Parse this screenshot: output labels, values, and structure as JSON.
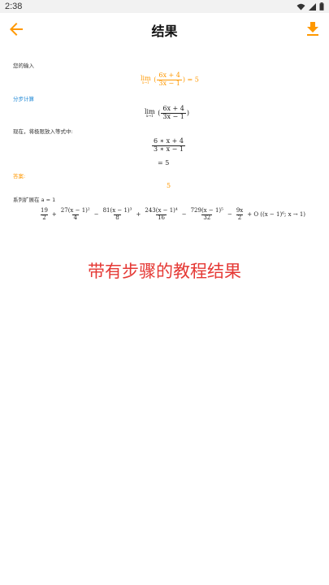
{
  "status_bar": {
    "time": "2:38"
  },
  "app_bar": {
    "title": "结果"
  },
  "result": {
    "input_label": "您的输入",
    "input_expr": {
      "lim_sub": "x→1",
      "numerator": "6x + 4",
      "denominator": "3x − 1",
      "rhs": "= 5"
    },
    "steps_label": "分步计算",
    "step_expr": {
      "lim_sub": "x→1",
      "numerator": "6x + 4",
      "denominator": "3x − 1"
    },
    "substitute_label": "现在，将极限放入等式中:",
    "substituted": {
      "numerator": "6 ∗ x + 4",
      "denominator": "3 ∗ x − 1",
      "equals": "= 5"
    },
    "answer_label": "答案:",
    "answer_value": "5",
    "series_label": "系列扩展在 a = 1",
    "series_terms": [
      {
        "num": "19",
        "den": "2"
      },
      {
        "op": "+"
      },
      {
        "num": "27(x − 1)²",
        "den": "4"
      },
      {
        "op": "−"
      },
      {
        "num": "81(x − 1)³",
        "den": "8"
      },
      {
        "op": "+"
      },
      {
        "num": "243(x − 1)⁴",
        "den": "16"
      },
      {
        "op": "−"
      },
      {
        "num": "729(x − 1)⁵",
        "den": "32"
      },
      {
        "op": "−"
      },
      {
        "num": "9x",
        "den": "2"
      },
      {
        "op": "+ O ((x − 1)⁶; x → 1)"
      }
    ]
  },
  "promo": {
    "headline": "带有步骤的教程结果"
  },
  "colors": {
    "accent": "#ff9800",
    "link": "#1e88d6",
    "headline": "#e53935"
  }
}
